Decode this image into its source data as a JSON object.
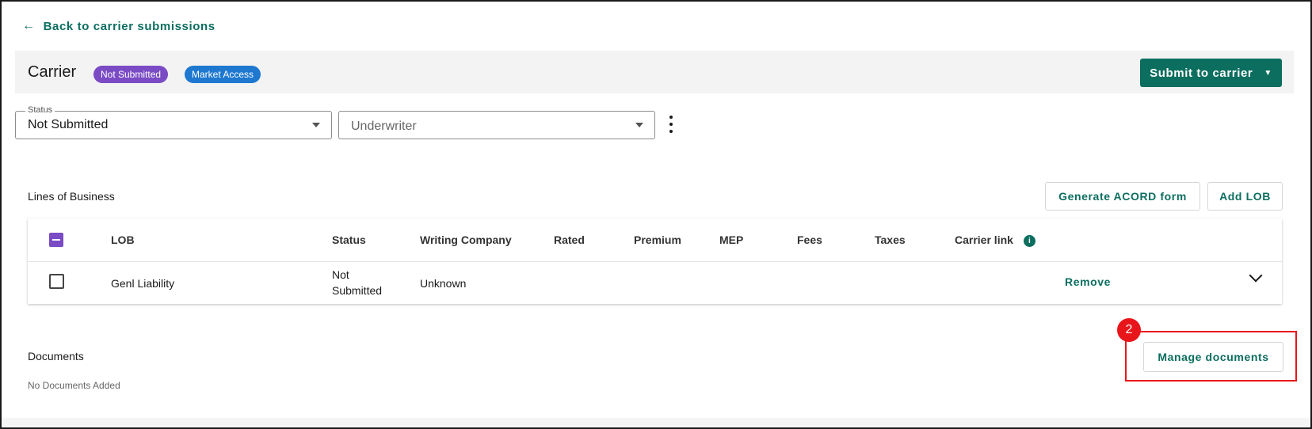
{
  "back_link": {
    "label": "Back to carrier submissions"
  },
  "header": {
    "title": "Carrier",
    "badges": [
      {
        "label": "Not Submitted",
        "color": "#7a4bc4"
      },
      {
        "label": "Market Access",
        "color": "#1e78d0"
      }
    ],
    "submit_button": {
      "label": "Submit to carrier"
    }
  },
  "filters": {
    "status": {
      "legend": "Status",
      "value": "Not Submitted"
    },
    "underwriter": {
      "placeholder": "Underwriter"
    }
  },
  "lines_of_business": {
    "title": "Lines of Business",
    "generate_button": "Generate ACORD form",
    "add_button": "Add LOB",
    "columns": [
      "LOB",
      "Status",
      "Writing Company",
      "Rated",
      "Premium",
      "MEP",
      "Fees",
      "Taxes",
      "Carrier link"
    ],
    "rows": [
      {
        "lob": "Genl Liability",
        "status_line1": "Not",
        "status_line2": "Submitted",
        "writing_company": "Unknown",
        "action": "Remove"
      }
    ]
  },
  "documents": {
    "title": "Documents",
    "empty_text": "No Documents Added",
    "manage_button": "Manage documents"
  },
  "annotation": {
    "step": "2",
    "color": "#e8161b"
  },
  "colors": {
    "accent": "#0b6e5f",
    "purple": "#7a4bc4",
    "blue": "#1e78d0"
  }
}
